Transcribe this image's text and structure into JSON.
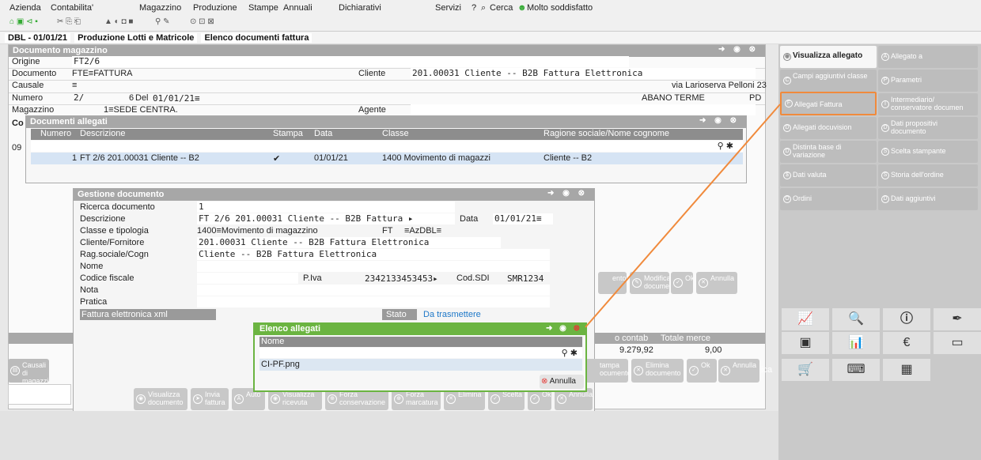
{
  "menu": {
    "items": [
      "Azienda",
      "Contabilita'",
      "Magazzino",
      "Produzione",
      "Stampe",
      "Annuali",
      "Dichiarativi",
      "Servizi",
      "?",
      "Cerca",
      "Molto soddisfatto"
    ]
  },
  "breadcrumb": {
    "tabs": [
      "DBL - 01/01/21",
      "Produzione Lotti e Matricole",
      "Elenco documenti fattura"
    ]
  },
  "doc_window": {
    "title": "Documento magazzino",
    "origine_label": "Origine",
    "origine_value": "FT2/6",
    "documento_label": "Documento",
    "documento_value": "FTE≡FATTURA",
    "causale_label": "Causale",
    "causale_value": "≡",
    "numero_label": "Numero",
    "numero_value": "2/",
    "numero_6": "6",
    "del_label": "Del",
    "del_value": "01/01/21≡",
    "magazzino_label": "Magazzino",
    "magazzino_value": "1≡SEDE CENTRA.",
    "cliente_label": "Cliente",
    "cliente_value": "201.00031 Cliente -- B2B Fattura Elettronica",
    "address": "via Larioserva Pelloni 23",
    "city": "ABANO TERME",
    "province": "PD",
    "agente_label": "Agente",
    "co_label": "Co",
    "row09": "09",
    "ro_contab": "o contab",
    "totale_merce": "Totale merce",
    "ro_contab_value": "9.279,92",
    "totale_merce_value": "9,00"
  },
  "allegati_window": {
    "title": "Documenti allegati",
    "columns": [
      "Numero",
      "Descrizione",
      "Stampa",
      "Data",
      "Classe",
      "Ragione sociale/Nome cognome"
    ],
    "row": {
      "numero": "1",
      "descrizione": "FT 2/6 201.00031 Cliente -- B2",
      "stampa": "✔",
      "data": "01/01/21",
      "classe": "1400 Movimento di magazzi",
      "ragione": "Cliente -- B2"
    }
  },
  "gestione_window": {
    "title": "Gestione documento",
    "ricerca_label": "Ricerca documento",
    "ricerca_value": "1",
    "descrizione_label": "Descrizione",
    "descrizione_value": "FT 2/6 201.00031 Cliente -- B2B Fattura ▸",
    "data_label": "Data",
    "data_value": "01/01/21≡",
    "classe_label": "Classe e tipologia",
    "classe_value": "1400≡Movimento di magazzino",
    "classe_ft": "FT",
    "classe_az": "≡AzDBL≡",
    "cliente_label": "Cliente/Fornitore",
    "cliente_value": "201.00031 Cliente -- B2B Fattura Elettronica",
    "rag_label": "Rag.sociale/Cogn",
    "rag_value": "Cliente -- B2B Fattura Elettronica",
    "nome_label": "Nome",
    "cf_label": "Codice fiscale",
    "piva_label": "P.Iva",
    "piva_value": "2342133453453▸",
    "sdi_label": "Cod.SDI",
    "sdi_value": "SMR1234",
    "nota_label": "Nota",
    "pratica_label": "Pratica",
    "fe_label": "Fattura elettronica xml",
    "stato_label": "Stato",
    "stato_value": "Da trasmettere"
  },
  "elenco_window": {
    "title": "Elenco allegati",
    "column": "Nome",
    "file": "CI-PF.png",
    "annulla": "Annulla"
  },
  "bottom_buttons": [
    "Visualizza documento",
    "Invia fattura",
    "Auto",
    "Visualizza ricevuta",
    "Forza conservazione",
    "Forza marcatura",
    "Elimina",
    "Scelta",
    "Ok",
    "Annulla"
  ],
  "mid_buttons": [
    "entoli",
    "Modifica documento",
    "Ok",
    "Annulla"
  ],
  "mid_buttons2": [
    "Causali di magazzino",
    "tampa ocumento",
    "Elimina documento",
    "Ok",
    "Annulla",
    "ica"
  ],
  "right_panel": {
    "buttons": [
      [
        "Visualizza allegato",
        "Allegato a"
      ],
      [
        "Campi aggiuntivi classe",
        "Parametri"
      ],
      [
        "Allegati Fattura",
        "Intermediario/ conservatore documen"
      ],
      [
        "Allegati docuvision",
        "Dati propositivi documento"
      ],
      [
        "Distinta base di variazione",
        "Scelta stampante"
      ],
      [
        "Dati valuta",
        "Storia dell'ordine"
      ],
      [
        "Ordini",
        "Dati aggiuntivi"
      ]
    ],
    "highlight_color": "#f08a3c"
  }
}
